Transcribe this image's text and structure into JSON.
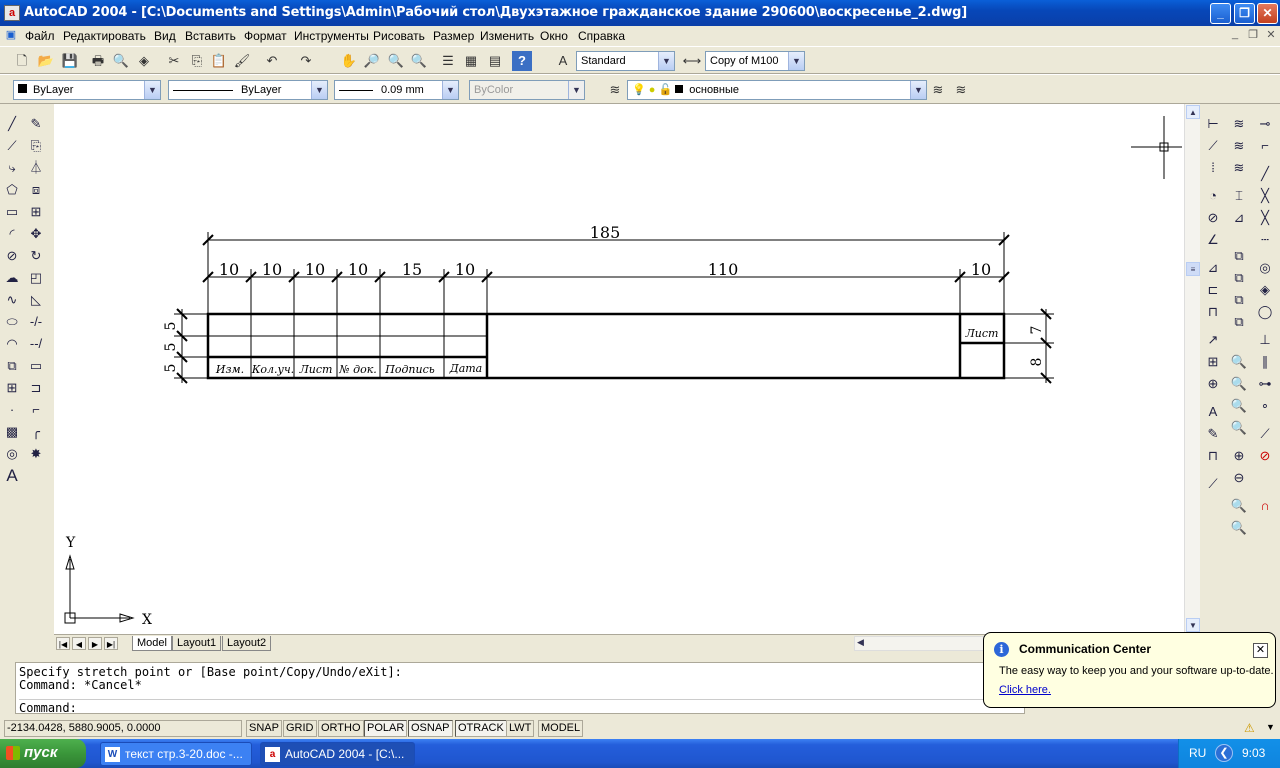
{
  "window": {
    "title": "AutoCAD 2004 - [C:\\Documents and Settings\\Admin\\Рабочий стол\\Двухэтажное гражданское здание 290600\\воскресенье_2.dwg]",
    "icon_label": "a"
  },
  "menu": [
    "Файл",
    "Редактировать",
    "Вид",
    "Вставить",
    "Формат",
    "Инструменты",
    "Рисовать",
    "Размер",
    "Изменить",
    "Окно",
    "Справка"
  ],
  "toolbars": {
    "text_style": "Standard",
    "dim_style": "Copy of M100",
    "color": "ByLayer",
    "linetype": "ByLayer",
    "lineweight": "0.09 mm",
    "plot_style": "ByColor",
    "layer": "основные"
  },
  "drawing": {
    "dims_top": [
      "10",
      "10",
      "10",
      "10",
      "15",
      "10",
      "110",
      "10"
    ],
    "overall_width": "185",
    "dims_left": [
      "5",
      "5",
      "5"
    ],
    "dims_right": [
      "7",
      "8"
    ],
    "table_headers": [
      "Изм.",
      "Кол.уч.",
      "Лист",
      "№ док.",
      "Подпись",
      "Дата"
    ],
    "sheet_label": "Лист",
    "ucs_x": "X",
    "ucs_y": "Y"
  },
  "tabs": [
    "Model",
    "Layout1",
    "Layout2"
  ],
  "command": {
    "line1": "Specify stretch point or [Base point/Copy/Undo/eXit]:",
    "line2": "Command: *Cancel*",
    "prompt": "Command:"
  },
  "status": {
    "coords": "-2134.0428, 5880.9005, 0.0000",
    "buttons": [
      "SNAP",
      "GRID",
      "ORTHO",
      "POLAR",
      "OSNAP",
      "OTRACK",
      "LWT",
      "MODEL"
    ]
  },
  "balloon": {
    "title": "Communication Center",
    "text": "The easy way to keep you and your software up-to-date.",
    "link": "Click here."
  },
  "taskbar": {
    "start": "пуск",
    "tasks": [
      "текст стр.3-20.doc -...",
      "AutoCAD 2004 - [C:\\..."
    ],
    "lang": "RU",
    "clock": "9:03"
  }
}
